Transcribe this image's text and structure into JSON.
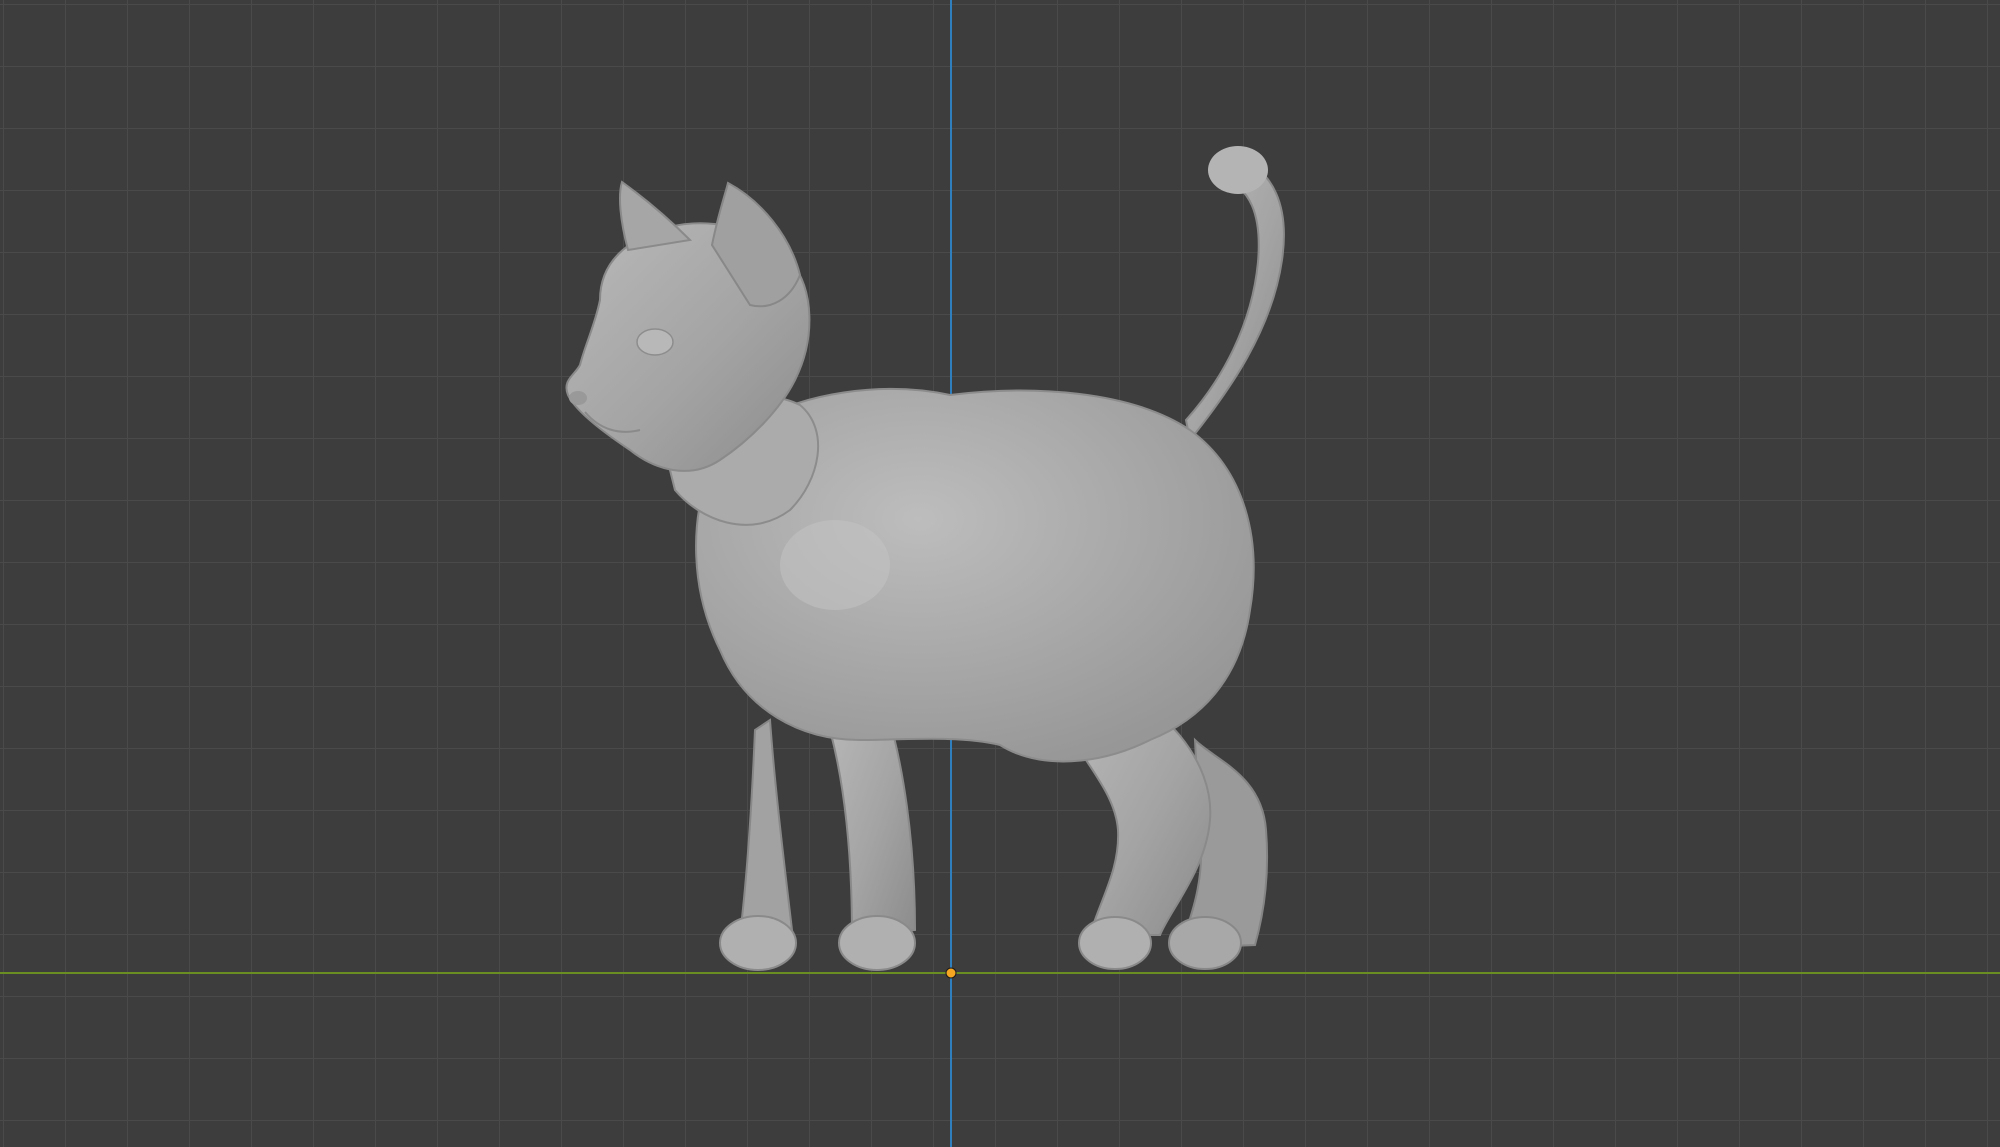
{
  "viewport": {
    "view": "side-orthographic",
    "background_color": "#3d3d3d",
    "grid_color": "#4a4a4a",
    "x_axis_color": "#6b8e23",
    "z_axis_color": "#2f7fbf",
    "origin_color": "#f5a623"
  },
  "object": {
    "type": "sculpted-cat-mesh",
    "material_color": "#a8a8a8"
  }
}
